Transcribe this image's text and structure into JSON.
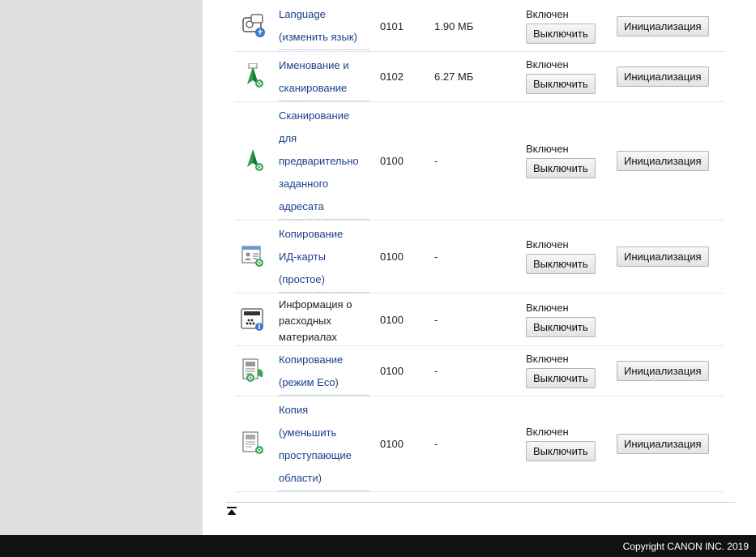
{
  "status_label": "Включен",
  "disable_label": "Выключить",
  "init_label": "Инициализация",
  "footer": {
    "copyright": "Copyright CANON INC. 2019"
  },
  "rows": [
    {
      "name_lines": [
        "Language",
        "(изменить язык)"
      ],
      "version": "0101",
      "size": "1.90 МБ",
      "icon": "language-icon",
      "link": true,
      "has_init": true
    },
    {
      "name_lines": [
        "Именование и",
        "сканирование"
      ],
      "version": "0102",
      "size": "6.27 МБ",
      "icon": "scan-naming-icon",
      "link": true,
      "has_init": true
    },
    {
      "name_lines": [
        "Сканирование",
        "для",
        "предварительно",
        "заданного",
        "адресата"
      ],
      "version": "0100",
      "size": "-",
      "icon": "scan-preset-destination-icon",
      "link": true,
      "has_init": true
    },
    {
      "name_lines": [
        "Копирование",
        "ИД-карты",
        "(простое)"
      ],
      "version": "0100",
      "size": "-",
      "icon": "id-card-copy-icon",
      "link": true,
      "has_init": true
    },
    {
      "name_lines": [
        "Информация о",
        "расходных",
        "материалах"
      ],
      "version": "0100",
      "size": "-",
      "icon": "consumables-info-icon",
      "link": false,
      "has_init": false
    },
    {
      "name_lines": [
        "Копирование",
        "(режим Eco)"
      ],
      "version": "0100",
      "size": "-",
      "icon": "eco-copy-icon",
      "link": true,
      "has_init": true
    },
    {
      "name_lines": [
        "Копия",
        "(уменьшить",
        "проступающие",
        "области)"
      ],
      "version": "0100",
      "size": "-",
      "icon": "reduce-bleed-copy-icon",
      "link": true,
      "has_init": true
    }
  ]
}
